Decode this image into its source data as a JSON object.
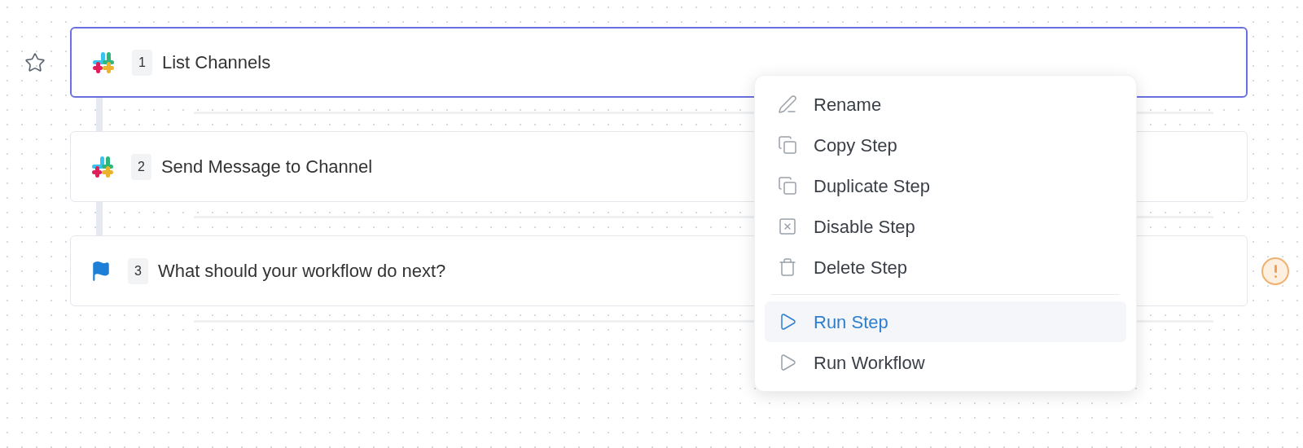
{
  "steps": [
    {
      "number": "1",
      "title": "List Channels",
      "kind": "slack",
      "selected": true,
      "star_shown": true,
      "warning": false
    },
    {
      "number": "2",
      "title": "Send Message to Channel",
      "kind": "slack",
      "selected": false,
      "star_shown": false,
      "warning": false
    },
    {
      "number": "3",
      "title": "What should your workflow do next?",
      "kind": "flag",
      "selected": false,
      "star_shown": false,
      "warning": true
    }
  ],
  "menu": {
    "groups": [
      [
        {
          "label": "Rename",
          "kind": "pencil",
          "highlighted": false
        },
        {
          "label": "Copy Step",
          "kind": "copy",
          "highlighted": false
        },
        {
          "label": "Duplicate Step",
          "kind": "copy",
          "highlighted": false
        },
        {
          "label": "Disable Step",
          "kind": "disable",
          "highlighted": false
        },
        {
          "label": "Delete Step",
          "kind": "trash",
          "highlighted": false
        }
      ],
      [
        {
          "label": "Run Step",
          "kind": "play",
          "highlighted": true
        },
        {
          "label": "Run Workflow",
          "kind": "play",
          "highlighted": false
        }
      ]
    ]
  }
}
